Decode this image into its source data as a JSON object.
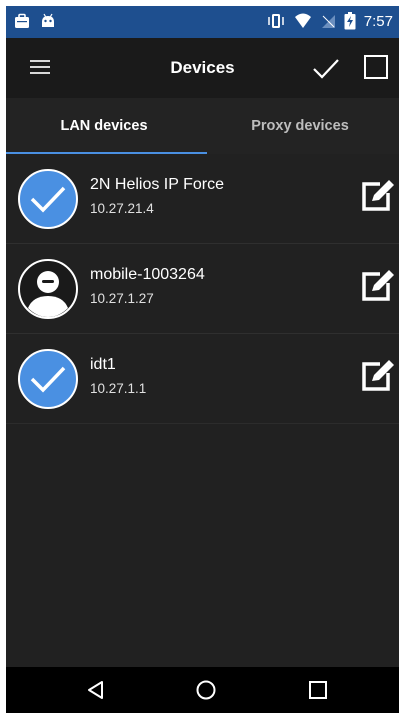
{
  "status_bar": {
    "time": "7:57",
    "icons": [
      "briefcase-icon",
      "android-icon",
      "vibrate-icon",
      "wifi-icon",
      "no-signal-icon",
      "battery-charging-icon"
    ]
  },
  "app_bar": {
    "title": "Devices",
    "menu_icon": "hamburger-menu-icon",
    "confirm_icon": "checkmark-icon",
    "select_all_icon": "checkbox-outline-icon"
  },
  "tabs": [
    {
      "label": "LAN devices",
      "selected": true
    },
    {
      "label": "Proxy devices",
      "selected": false
    }
  ],
  "devices": [
    {
      "name": "2N Helios IP Force",
      "ip": "10.27.21.4",
      "avatar": "selected-check-icon"
    },
    {
      "name": "mobile-1003264",
      "ip": "10.27.1.27",
      "avatar": "person-icon"
    },
    {
      "name": "idt1",
      "ip": "10.27.1.1",
      "avatar": "selected-check-icon"
    }
  ],
  "nav_bar": {
    "icons": [
      "back-icon",
      "home-icon",
      "recents-icon"
    ]
  },
  "colors": {
    "status_bar": "#1e4f8f",
    "app_bar": "#1a1a1a",
    "background": "#212121",
    "accent": "#4a90e2",
    "nav_bar": "#000000"
  }
}
